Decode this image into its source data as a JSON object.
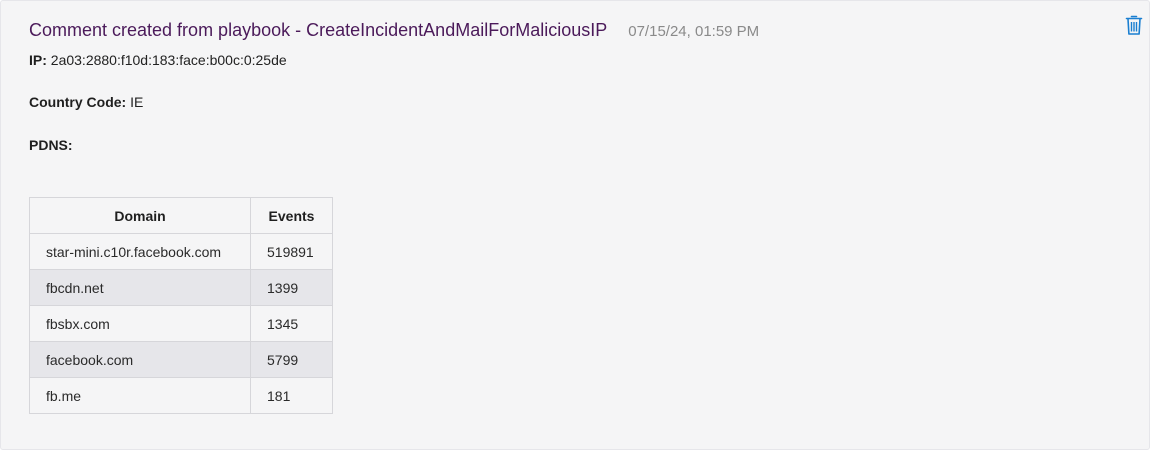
{
  "comment": {
    "title": "Comment created from playbook - CreateIncidentAndMailForMaliciousIP",
    "timestamp": "07/15/24, 01:59 PM",
    "delete_icon": "trash-icon",
    "accent_color": "#4b1a5a",
    "icon_color": "#1a7fd1"
  },
  "fields": {
    "ip_label": "IP:",
    "ip_value": "2a03:2880:f10d:183:face:b00c:0:25de",
    "country_label": "Country Code:",
    "country_value": "IE",
    "pdns_label": "PDNS:"
  },
  "table": {
    "headers": [
      "Domain",
      "Events"
    ],
    "rows": [
      {
        "domain": "star-mini.c10r.facebook.com",
        "events": "519891"
      },
      {
        "domain": "fbcdn.net",
        "events": "1399"
      },
      {
        "domain": "fbsbx.com",
        "events": "1345"
      },
      {
        "domain": "facebook.com",
        "events": "5799"
      },
      {
        "domain": "fb.me",
        "events": "181"
      }
    ]
  }
}
